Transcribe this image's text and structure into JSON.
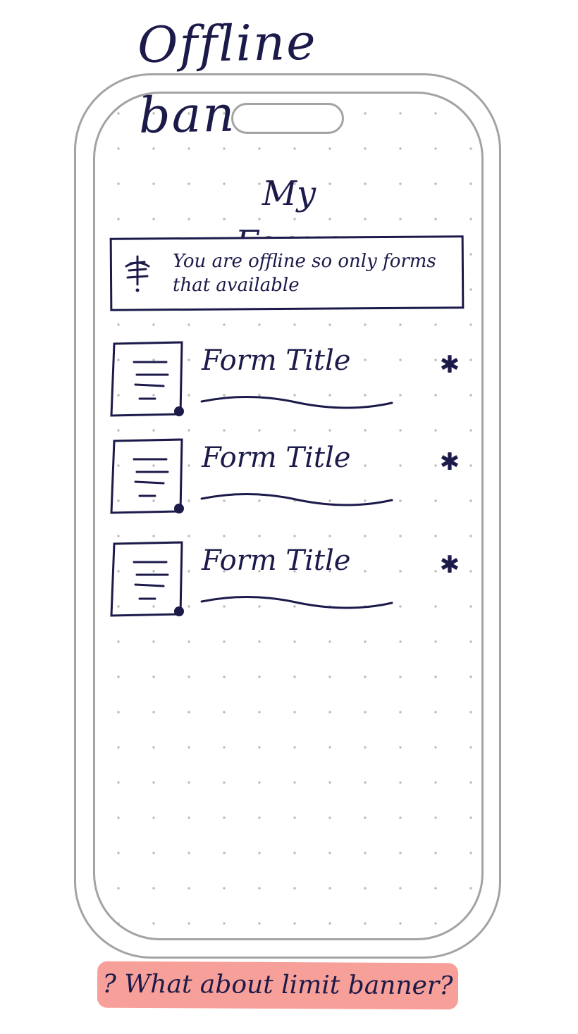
{
  "sketch_title": "Offline banner",
  "screen": {
    "title": "My Forms",
    "offline_banner": {
      "icon": "offline-signal-icon",
      "text": "You are offline so only forms that available"
    },
    "forms": [
      {
        "title": "Form Title",
        "icon": "document-icon",
        "favorite_icon": "star-icon"
      },
      {
        "title": "Form Title",
        "icon": "document-icon",
        "favorite_icon": "star-icon"
      },
      {
        "title": "Form Title",
        "icon": "document-icon",
        "favorite_icon": "star-icon"
      }
    ]
  },
  "footer_note": "? What about limit banner?",
  "colors": {
    "ink": "#1c1a4a",
    "frame": "#a3a3a3",
    "highlight": "#f4786e"
  }
}
